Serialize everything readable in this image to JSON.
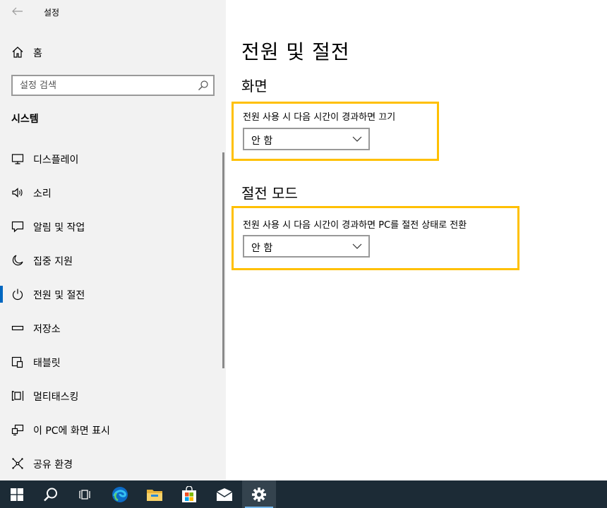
{
  "window": {
    "title": "설정"
  },
  "sidebar": {
    "home_label": "홈",
    "search_placeholder": "설정 검색",
    "section": "시스템",
    "items": [
      {
        "label": "디스플레이",
        "icon": "monitor-icon"
      },
      {
        "label": "소리",
        "icon": "speaker-icon"
      },
      {
        "label": "알림 및 작업",
        "icon": "notification-icon"
      },
      {
        "label": "집중 지원",
        "icon": "moon-icon"
      },
      {
        "label": "전원 및 절전",
        "icon": "power-icon",
        "active": true
      },
      {
        "label": "저장소",
        "icon": "storage-icon"
      },
      {
        "label": "태블릿",
        "icon": "tablet-icon"
      },
      {
        "label": "멀티태스킹",
        "icon": "multitasking-icon"
      },
      {
        "label": "이 PC에 화면 표시",
        "icon": "project-icon"
      },
      {
        "label": "공유 환경",
        "icon": "share-icon"
      }
    ]
  },
  "main": {
    "title": "전원 및 절전",
    "screen": {
      "heading": "화면",
      "label": "전원 사용 시 다음 시간이 경과하면 끄기",
      "value": "안 함"
    },
    "sleep": {
      "heading": "절전 모드",
      "label": "전원 사용 시 다음 시간이 경과하면 PC를 절전 상태로 전환",
      "value": "안 함"
    },
    "highlight_color": "#ffc000"
  },
  "taskbar": {
    "items": [
      "windows-start-icon",
      "search-icon",
      "task-view-icon",
      "edge-icon",
      "file-explorer-icon",
      "store-icon",
      "mail-icon",
      "settings-gear-icon"
    ],
    "active": "settings-gear-icon"
  },
  "colors": {
    "accent": "#0067c0",
    "sidebar_bg": "#f2f2f2",
    "taskbar_bg": "#1c2b36"
  }
}
